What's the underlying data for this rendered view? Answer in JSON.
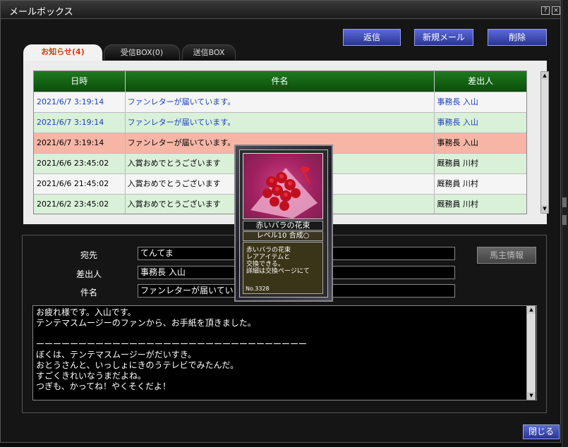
{
  "window": {
    "title": "メールボックス",
    "help_label": "?",
    "close_label": "×"
  },
  "toolbar": {
    "reply": "返信",
    "new_mail": "新規メール",
    "delete": "削除"
  },
  "tabs": [
    {
      "label": "お知らせ(4)",
      "active": true
    },
    {
      "label": "受信BOX(0)",
      "active": false
    },
    {
      "label": "送信BOX",
      "active": false
    }
  ],
  "table": {
    "headers": [
      "日時",
      "件名",
      "差出人"
    ],
    "rows": [
      {
        "date": "2021/6/7 3:19:14",
        "subject": "ファンレターが届いています。",
        "sender": "事務長 入山",
        "bg": "#f5f5f5",
        "color": "#1a3fc0"
      },
      {
        "date": "2021/6/7 3:19:14",
        "subject": "ファンレターが届いています。",
        "sender": "事務長 入山",
        "bg": "#d9f0d9",
        "color": "#1a3fc0"
      },
      {
        "date": "2021/6/7 3:19:14",
        "subject": "ファンレターが届いています。",
        "sender": "事務長 入山",
        "bg": "#f7b5a5",
        "color": "#000000"
      },
      {
        "date": "2021/6/6 23:45:02",
        "subject": "入賞おめでとうございます",
        "sender": "厩務員 川村",
        "bg": "#d9f0d9",
        "color": "#000000"
      },
      {
        "date": "2021/6/6 21:45:02",
        "subject": "入賞おめでとうございます",
        "sender": "厩務員 川村",
        "bg": "#f5f5f5",
        "color": "#000000"
      },
      {
        "date": "2021/6/2 23:45:02",
        "subject": "入賞おめでとうございます",
        "sender": "厩務員 川村",
        "bg": "#d9f0d9",
        "color": "#000000"
      }
    ]
  },
  "detail": {
    "to_label": "宛先",
    "to_value": "てんてま",
    "from_label": "差出人",
    "from_value": "事務長 入山",
    "subject_label": "件名",
    "subject_value": "ファンレターが届いていま",
    "owner_info_button": "馬主情報",
    "body": "お疲れ様です。入山です。\nテンテマスムージーのファンから、お手紙を頂きました。\n\nーーーーーーーーーーーーーーーーーーーーーーーーーーーーーーーー\nぼくは、テンテマスムージーがだいすき。\nおとうさんと、いっしょにきのうテレビでみたんだ。\nすごくきれいなうまだよね。\nつぎも、かってね！やくそくだよ！"
  },
  "card": {
    "name": "赤いバラの花束",
    "level": "レベル10  合成○",
    "desc_lines": [
      "赤いバラの花束",
      "レアアイテムと",
      "交換できる。",
      "詳細は交換ページにて"
    ],
    "number": "No.3328"
  },
  "footer": {
    "close": "閉じる"
  }
}
